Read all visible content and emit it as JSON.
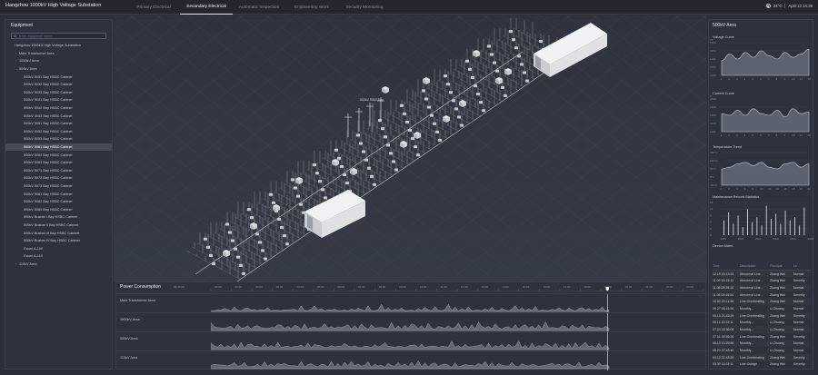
{
  "header": {
    "title": "Hangzhou 1000kV High Voltage Substation",
    "tabs": [
      {
        "label": "Primary Electrical"
      },
      {
        "label": "Secondary Electrical"
      },
      {
        "label": "Automatic Inspection"
      },
      {
        "label": "Engineering Work"
      },
      {
        "label": "Security Monitoring"
      }
    ],
    "active_tab": 1,
    "weather": "24°C",
    "datetime": "April 12  14:39"
  },
  "equipment": {
    "title": "Equipment",
    "search_placeholder": "Enter equipment name",
    "items": [
      {
        "label": "Hangzhou 1000kV High Voltage Substation",
        "level": 0,
        "caret": ""
      },
      {
        "label": "Main Transformer Area",
        "level": 1,
        "caret": "›"
      },
      {
        "label": "1000kV Area",
        "level": 1,
        "caret": "›"
      },
      {
        "label": "500kV Area",
        "level": 1,
        "caret": "⌄"
      },
      {
        "label": "500kV 5031 Bay HSBC Cabinet",
        "level": 2,
        "caret": ""
      },
      {
        "label": "500kV 5032 Bay HSBC Cabinet",
        "level": 2,
        "caret": ""
      },
      {
        "label": "500kV 5033 Bay HSBC Cabinet",
        "level": 2,
        "caret": ""
      },
      {
        "label": "500kV 5041 Bay HSBC Cabinet",
        "level": 2,
        "caret": ""
      },
      {
        "label": "500kV 5042 Bay HSBC Cabinet",
        "level": 2,
        "caret": ""
      },
      {
        "label": "500kV 5043 Bay HSBC Cabinet",
        "level": 2,
        "caret": ""
      },
      {
        "label": "500kV 5051 Bay HSBC Cabinet",
        "level": 2,
        "caret": ""
      },
      {
        "label": "500kV 5052 Bay HSBC Cabinet",
        "level": 2,
        "caret": ""
      },
      {
        "label": "500kV 5053 Bay HSBC Cabinet",
        "level": 2,
        "caret": ""
      },
      {
        "label": "500kV 5061 Bay HSBC Cabinet",
        "level": 2,
        "caret": ""
      },
      {
        "label": "500kV 5062 Bay HSBC Cabinet",
        "level": 2,
        "caret": ""
      },
      {
        "label": "500kV 5063 Bay HSBC Cabinet",
        "level": 2,
        "caret": ""
      },
      {
        "label": "500kV 5071 Bay HSBC Cabinet",
        "level": 2,
        "caret": ""
      },
      {
        "label": "500kV 5072 Bay HSBC Cabinet",
        "level": 2,
        "caret": ""
      },
      {
        "label": "500kV 5073 Bay HSBC Cabinet",
        "level": 2,
        "caret": ""
      },
      {
        "label": "500kV 5081 Bay HSBC Cabinet",
        "level": 2,
        "caret": ""
      },
      {
        "label": "500kV 5082 Bay HSBC Cabinet",
        "level": 2,
        "caret": ""
      },
      {
        "label": "500kV 5083 Bay HSBC Cabinet",
        "level": 2,
        "caret": ""
      },
      {
        "label": "500kV Busbar I Bay HSBC Cabinet",
        "level": 2,
        "caret": ""
      },
      {
        "label": "500kV Busbar II Bay HSBC Cabinet",
        "level": 2,
        "caret": ""
      },
      {
        "label": "500kV Busbar III Bay HSBC Cabinet",
        "level": 2,
        "caret": ""
      },
      {
        "label": "500kV Busbar IV Bay HSBC Cabinet",
        "level": 2,
        "caret": ""
      },
      {
        "label": "Room A-100",
        "level": 2,
        "caret": ""
      },
      {
        "label": "Room A-110",
        "level": 2,
        "caret": ""
      },
      {
        "label": "110kV Area",
        "level": 1,
        "caret": "›"
      }
    ],
    "selected_index": 13
  },
  "scene": {
    "callout": "500kV 5063 Bay"
  },
  "right_panel": {
    "title": "500kV Area",
    "voltage": {
      "title": "Voltage Curve",
      "unit": "kV",
      "yticks": [
        "1200",
        "1150",
        "1100",
        "1050",
        "1000"
      ],
      "xticks": [
        "1",
        "2",
        "3",
        "4",
        "5",
        "6",
        "7",
        "8",
        "9",
        "10",
        "11",
        "12"
      ]
    },
    "current": {
      "title": "Current Curve",
      "unit": "A",
      "yticks": [
        "1500",
        "1400",
        "1300",
        "1200",
        "1100"
      ],
      "xticks": [
        "1",
        "2",
        "3",
        "4",
        "5",
        "6",
        "7",
        "8",
        "9",
        "10",
        "11",
        "12"
      ]
    },
    "temperature": {
      "title": "Temperature Trend",
      "yticks": [
        "150°C",
        "100°C",
        "50°C",
        "0°C",
        "-50°C"
      ],
      "xticks": [
        "0",
        "2",
        "4",
        "6",
        "8",
        "10",
        "12",
        "14",
        "16",
        "18",
        "20",
        "22"
      ]
    },
    "maintenance": {
      "title": "Maintenance Record Statistics",
      "yticks": [
        "15",
        "12",
        "9",
        "6",
        "3",
        "0"
      ],
      "xticks": [
        "2019",
        "2020",
        "2021",
        "2022",
        "2023",
        "2024"
      ]
    },
    "alarm": {
      "title": "Device Alarm",
      "columns": [
        "Time",
        "Description",
        "Principal",
        "Le"
      ],
      "rows": [
        [
          "12.19 15:13:24",
          "Abnormal Line...",
          "Zhang Wei",
          "Normal"
        ],
        [
          "11.09 15:13:13",
          "Abnormal Line...",
          "Zhang Wei",
          "Severity"
        ],
        [
          "11.08 09:39:18",
          "Abnormal Line...",
          "Zhang Wei",
          "Normal"
        ],
        [
          "11.08 09:48:54",
          "Abnormal Line...",
          "Zhang Wei",
          "Severity"
        ],
        [
          "10.02 23:11:45",
          "Line Overheating",
          "Zhang Wei",
          "Normal"
        ],
        [
          "09.27 08:15:36",
          "Monthly...",
          "Li Zhuang",
          "Normal"
        ],
        [
          "09.13 21:43:29",
          "Line Overheating",
          "Zhang Wei",
          "Severity"
        ],
        [
          "08.11 10:22:11",
          "Monthly...",
          "Li Zhuang",
          "Normal"
        ],
        [
          "07.24 18:36:09",
          "Monthly...",
          "Li Zhuang",
          "Normal"
        ],
        [
          "07.01 09:55:26",
          "Line Overheating",
          "Zhang Wei",
          "Severity"
        ],
        [
          "06.13 13:29:59",
          "Monthly...",
          "Li Zhuang",
          "Normal"
        ],
        [
          "05.20 07:43:45",
          "Monthly...",
          "Li Zhuang",
          "Normal"
        ],
        [
          "04.12 21:43:29",
          "Line Overheating",
          "Zhang Wei",
          "Severity"
        ],
        [
          "03.30 11:03:11",
          "Line Outage",
          "Zhang Wei",
          "Severity"
        ]
      ]
    }
  },
  "power": {
    "title": "Power Consumption",
    "first_tick": "09:45:00",
    "ticks": [
      "00:00",
      "01:00",
      "02:00",
      "03:00",
      "04:00",
      "05:00",
      "06:00",
      "07:00",
      "08:00",
      "09:00",
      "10:00",
      "11:00",
      "12:00",
      "13:00",
      "14:00",
      "15:00",
      "16:00",
      "17:00",
      "18:00",
      "19:00",
      "20:00",
      "21:00",
      "22:00",
      "23:00",
      "24:00"
    ],
    "cursor_position": 0.805,
    "rows": [
      {
        "label": "Main Transformer Area"
      },
      {
        "label": "1000kV Area"
      },
      {
        "label": "500kV Area"
      },
      {
        "label": "110kV Area"
      }
    ]
  }
}
